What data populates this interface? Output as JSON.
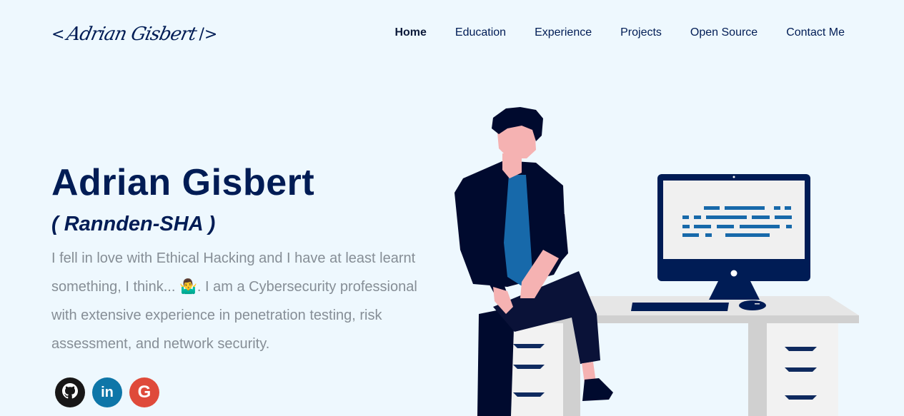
{
  "logo": {
    "open_bracket": "<",
    "signature": "Adrian Gisbert",
    "close_bracket": "/>"
  },
  "nav": {
    "items": [
      {
        "label": "Home",
        "active": true
      },
      {
        "label": "Education",
        "active": false
      },
      {
        "label": "Experience",
        "active": false
      },
      {
        "label": "Projects",
        "active": false
      },
      {
        "label": "Open Source",
        "active": false
      },
      {
        "label": "Contact Me",
        "active": false
      }
    ]
  },
  "hero": {
    "name": "Adrian Gisbert",
    "alias": "( Rannden-SHA )",
    "bio": "I fell in love with Ethical Hacking and I have at least learnt something, I think... 🤷‍♂️. I am a Cybersecurity professional with extensive experience in penetration testing, risk assessment, and network security."
  },
  "socials": [
    {
      "name": "github",
      "icon": "github-icon",
      "glyph": "",
      "color": "#181717"
    },
    {
      "name": "linkedin",
      "icon": "linkedin-icon",
      "glyph": "in",
      "color": "#0e76a8"
    },
    {
      "name": "google",
      "icon": "google-icon",
      "glyph": "G",
      "color": "#df4a3a"
    }
  ],
  "colors": {
    "background": "#eef8fe",
    "primary": "#001c55",
    "text_muted": "#868e96",
    "accent_blue": "#1769aa"
  }
}
